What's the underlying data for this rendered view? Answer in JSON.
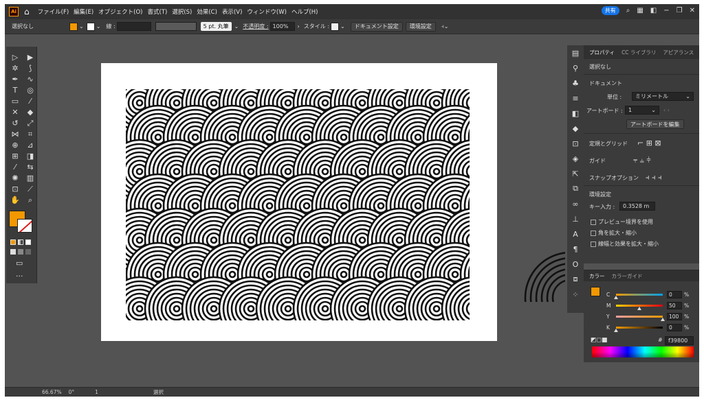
{
  "menubar": {
    "app_badge": "Ai",
    "menus": [
      "ファイル(F)",
      "編集(E)",
      "オブジェクト(O)",
      "書式(T)",
      "選択(S)",
      "効果(C)",
      "表示(V)",
      "ウィンドウ(W)",
      "ヘルプ(H)"
    ],
    "share_label": "共有"
  },
  "controlbar": {
    "selection": "選択なし",
    "fill_color": "#f39800",
    "stroke_label": "線 :",
    "brush": "5 pt. 丸筆",
    "opacity_label": "不透明度 :",
    "opacity_value": "100%",
    "style_label": "スタイル :",
    "doc_settings": "ドキュメント設定",
    "prefs": "環境設定"
  },
  "properties": {
    "tabs": [
      "プロパティ",
      "CC ライブラリ",
      "アピアランス"
    ],
    "selection": "選択なし",
    "document_heading": "ドキュメント",
    "units_label": "単位 :",
    "units_value": "ミリメートル",
    "artboard_label": "アートボード :",
    "artboard_value": "1",
    "edit_artboard": "アートボードを編集",
    "rulers_grids": "定規とグリッド",
    "guides": "ガイド",
    "snap": "スナップオプション",
    "prefs_heading": "環境設定",
    "key_increment_label": "キー入力 :",
    "key_increment_value": "0.3528 m",
    "cb_preview": "プレビュー境界を使用",
    "cb_corners": "角を拡大・縮小",
    "cb_strokes": "線幅と効果を拡大・縮小"
  },
  "color_panel": {
    "tabs": [
      "カラー",
      "カラーガイド"
    ],
    "channels": [
      {
        "label": "C",
        "value": "0",
        "pct": 0,
        "grad": "linear-gradient(90deg,#f39800,#00a0e9)"
      },
      {
        "label": "M",
        "value": "50",
        "pct": 50,
        "grad": "linear-gradient(90deg,#ffd100,#e60012)"
      },
      {
        "label": "Y",
        "value": "100",
        "pct": 100,
        "grad": "linear-gradient(90deg,#f39da0,#f39800)"
      },
      {
        "label": "K",
        "value": "0",
        "pct": 0,
        "grad": "linear-gradient(90deg,#f39800,#000)"
      }
    ],
    "percent": "%",
    "hex": "f39800"
  },
  "status": {
    "zoom": "66.67%",
    "rotation": "0°",
    "artboard": "1",
    "tool": "選択"
  }
}
